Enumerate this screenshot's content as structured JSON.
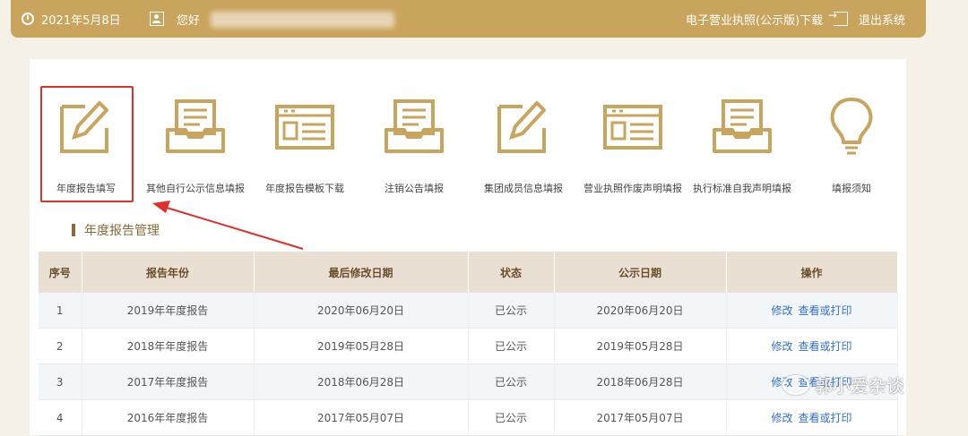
{
  "topbar": {
    "date": "2021年5月8日",
    "greeting": "您好",
    "license_download": "电子营业执照(公示版)下载",
    "logout": "退出系统"
  },
  "nav": [
    {
      "label": "年度报告填写",
      "icon": "edit-icon"
    },
    {
      "label": "其他自行公示信息填报",
      "icon": "inbox-icon"
    },
    {
      "label": "年度报告模板下载",
      "icon": "template-icon"
    },
    {
      "label": "注销公告填报",
      "icon": "inbox-icon"
    },
    {
      "label": "集团成员信息填报",
      "icon": "edit-icon"
    },
    {
      "label": "营业执照作废声明填报",
      "icon": "template-icon"
    },
    {
      "label": "执行标准自我声明填报",
      "icon": "inbox-icon"
    },
    {
      "label": "填报须知",
      "icon": "lightbulb-icon"
    }
  ],
  "section_title": "年度报告管理",
  "table": {
    "headers": [
      "序号",
      "报告年份",
      "最后修改日期",
      "状态",
      "公示日期",
      "操作"
    ],
    "rows": [
      {
        "no": "1",
        "year": "2019年年度报告",
        "modified": "2020年06月20日",
        "status": "已公示",
        "published": "2020年06月20日"
      },
      {
        "no": "2",
        "year": "2018年年度报告",
        "modified": "2019年05月28日",
        "status": "已公示",
        "published": "2019年05月28日"
      },
      {
        "no": "3",
        "year": "2017年年度报告",
        "modified": "2018年06月28日",
        "status": "已公示",
        "published": "2018年06月28日"
      },
      {
        "no": "4",
        "year": "2016年年度报告",
        "modified": "2017年05月07日",
        "status": "已公示",
        "published": "2017年05月07日"
      }
    ],
    "action_edit": "修改",
    "action_view": "查看或打印"
  },
  "watermark": "郭小爱杂谈",
  "colors": {
    "gold": "#c9a45d",
    "highlight": "#e0302a",
    "link": "#2f6fd0"
  }
}
